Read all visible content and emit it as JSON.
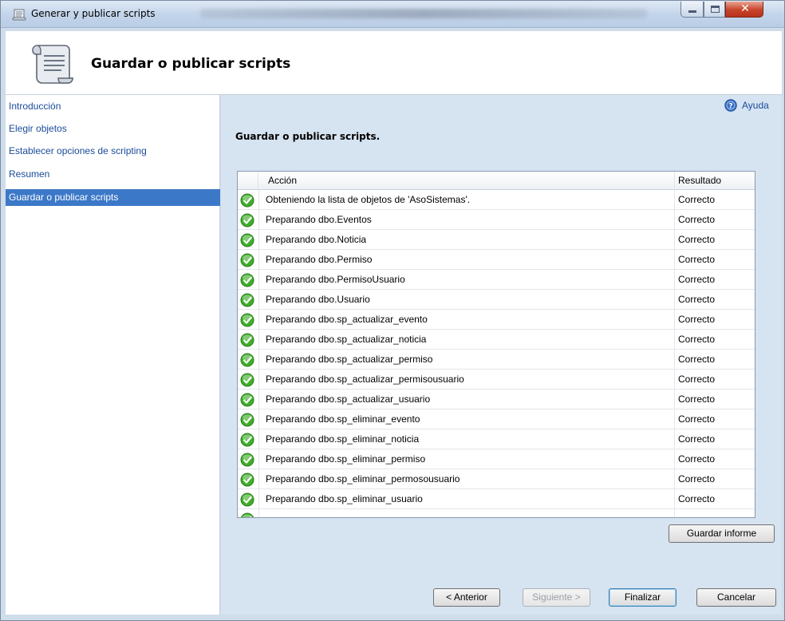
{
  "window": {
    "title": "Generar y publicar scripts"
  },
  "header": {
    "heading": "Guardar o publicar scripts"
  },
  "sidebar": {
    "items": [
      {
        "label": "Introducción",
        "active": false
      },
      {
        "label": "Elegir objetos",
        "active": false
      },
      {
        "label": "Establecer opciones de scripting",
        "active": false
      },
      {
        "label": "Resumen",
        "active": false
      },
      {
        "label": "Guardar o publicar scripts",
        "active": true
      }
    ]
  },
  "main": {
    "help_label": "Ayuda",
    "section_title": "Guardar o publicar scripts.",
    "grid": {
      "columns": [
        "Acción",
        "Resultado"
      ],
      "rows": [
        {
          "accion": "Obteniendo la lista de objetos de 'AsoSistemas'.",
          "resultado": "Correcto"
        },
        {
          "accion": "Preparando dbo.Eventos",
          "resultado": "Correcto"
        },
        {
          "accion": "Preparando dbo.Noticia",
          "resultado": "Correcto"
        },
        {
          "accion": "Preparando dbo.Permiso",
          "resultado": "Correcto"
        },
        {
          "accion": "Preparando dbo.PermisoUsuario",
          "resultado": "Correcto"
        },
        {
          "accion": "Preparando dbo.Usuario",
          "resultado": "Correcto"
        },
        {
          "accion": "Preparando dbo.sp_actualizar_evento",
          "resultado": "Correcto"
        },
        {
          "accion": "Preparando dbo.sp_actualizar_noticia",
          "resultado": "Correcto"
        },
        {
          "accion": "Preparando dbo.sp_actualizar_permiso",
          "resultado": "Correcto"
        },
        {
          "accion": "Preparando dbo.sp_actualizar_permisousuario",
          "resultado": "Correcto"
        },
        {
          "accion": "Preparando dbo.sp_actualizar_usuario",
          "resultado": "Correcto"
        },
        {
          "accion": "Preparando dbo.sp_eliminar_evento",
          "resultado": "Correcto"
        },
        {
          "accion": "Preparando dbo.sp_eliminar_noticia",
          "resultado": "Correcto"
        },
        {
          "accion": "Preparando dbo.sp_eliminar_permiso",
          "resultado": "Correcto"
        },
        {
          "accion": "Preparando dbo.sp_eliminar_permosousuario",
          "resultado": "Correcto"
        },
        {
          "accion": "Preparando dbo.sp_eliminar_usuario",
          "resultado": "Correcto"
        },
        {
          "accion": "",
          "resultado": ""
        }
      ],
      "status_icon": "success-check-icon",
      "status_color": "#3fae2a"
    },
    "save_report_label": "Guardar informe"
  },
  "footer": {
    "prev_label": "< Anterior",
    "next_label": "Siguiente >",
    "finish_label": "Finalizar",
    "cancel_label": "Cancelar"
  },
  "colors": {
    "sidebar_active_bg": "#3c78c8",
    "link_color": "#1a4b9a",
    "panel_bg": "#d6e3f1"
  }
}
